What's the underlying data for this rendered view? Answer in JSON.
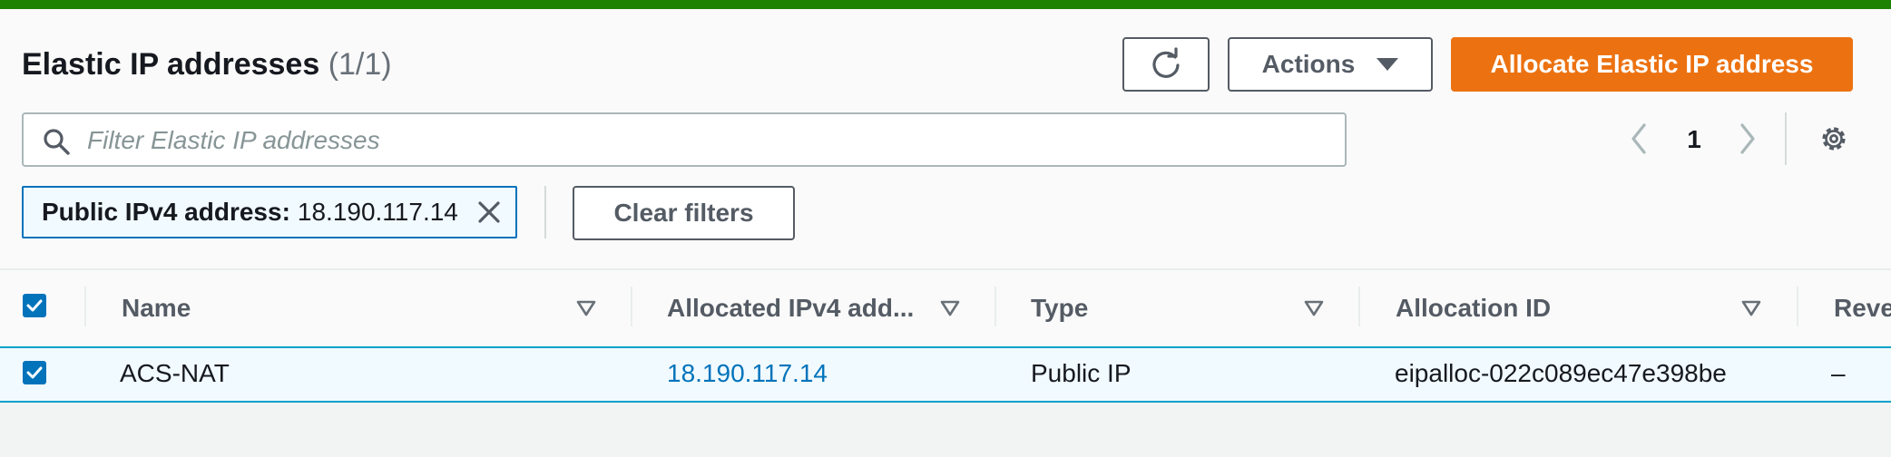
{
  "header": {
    "title": "Elastic IP addresses",
    "count": "(1/1)",
    "actions_label": "Actions",
    "allocate_label": "Allocate Elastic IP address"
  },
  "search": {
    "placeholder": "Filter Elastic IP addresses",
    "value": ""
  },
  "pagination": {
    "current_page": "1"
  },
  "filter": {
    "key": "Public IPv4 address:",
    "value": "18.190.117.14",
    "clear_label": "Clear filters"
  },
  "table": {
    "columns": [
      "Name",
      "Allocated IPv4 add...",
      "Type",
      "Allocation ID",
      "Reve"
    ],
    "rows": [
      {
        "selected": true,
        "name": "ACS-NAT",
        "ipv4": "18.190.117.14",
        "type": "Public IP",
        "allocation_id": "eipalloc-022c089ec47e398be",
        "reverse_dns": "–"
      }
    ]
  },
  "colors": {
    "top_bar": "#1d8102",
    "primary_button": "#ec7211",
    "link": "#0073bb",
    "selected_row_border": "#00a1c9"
  },
  "icons": [
    "refresh-icon",
    "caret-down-icon",
    "search-icon",
    "chevron-left-icon",
    "chevron-right-icon",
    "gear-icon",
    "close-icon",
    "sort-icon",
    "checkbox-checked-icon"
  ]
}
